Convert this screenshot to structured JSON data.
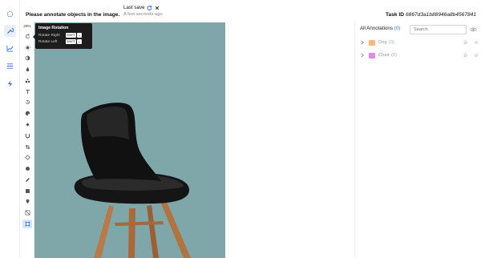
{
  "header": {
    "title": "Please annotate objects in the image.",
    "save_title": "Last save",
    "save_time": "A few seconds ago",
    "task_label": "Task ID",
    "task_id": "6867d3a1b88946a8b4567841"
  },
  "nav": {
    "items": [
      "logo-icon",
      "wrench-icon",
      "chart-icon",
      "list-icon",
      "bolt-icon"
    ]
  },
  "toolbar": {
    "zoom": "28%",
    "tools": [
      "rotate-icon",
      "brightness-icon",
      "contrast-icon",
      "drop-icon",
      "shapes-icon",
      "text-icon",
      "history-icon",
      "palette-icon",
      "fill-icon",
      "magnet-icon",
      "crop-icon",
      "polygon-icon",
      "sphere-icon",
      "pen-icon",
      "box-icon",
      "pin-icon",
      "mask-icon",
      "bbox-icon"
    ]
  },
  "tooltip": {
    "title": "Image Rotation",
    "rotate_right": "Rotate Right",
    "rotate_left": "Rotate Left",
    "kbd_shift": "SHIFT",
    "kbd_right": "→",
    "kbd_left": "←"
  },
  "panel": {
    "heading": "All Annotations",
    "heading_count": "(0)",
    "search_placeholder": "Search",
    "annotations": [
      {
        "label": "Dog",
        "count": "(0)",
        "color": "#f7b97f"
      },
      {
        "label": "Chair",
        "count": "(0)",
        "color": "#e38be8"
      }
    ]
  },
  "colors": {
    "canvas_bg": "#7fa6a9",
    "accent": "#3b6fd6"
  }
}
